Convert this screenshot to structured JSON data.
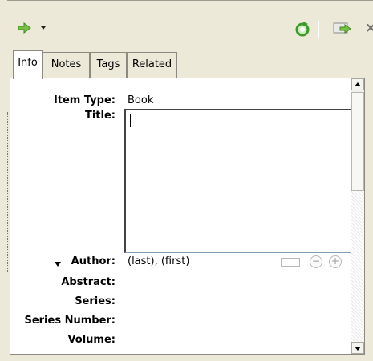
{
  "toolbar": {
    "go_icon": "green-arrow-icon",
    "dropdown_icon": "dropdown-caret-icon",
    "refresh_icon": "refresh-icon",
    "forward_icon": "forward-arrow-icon",
    "close_label": "×",
    "accent": "#4aa832"
  },
  "tabs": [
    {
      "label": "Info",
      "active": true
    },
    {
      "label": "Notes",
      "active": false
    },
    {
      "label": "Tags",
      "active": false
    },
    {
      "label": "Related",
      "active": false
    }
  ],
  "fields": {
    "item_type_label": "Item Type:",
    "item_type_value": "Book",
    "title_label": "Title:",
    "title_value": "",
    "author_label": "Author:",
    "author_value": "(last), (first)",
    "abstract_label": "Abstract:",
    "series_label": "Series:",
    "series_number_label": "Series Number:",
    "volume_label": "Volume:"
  }
}
